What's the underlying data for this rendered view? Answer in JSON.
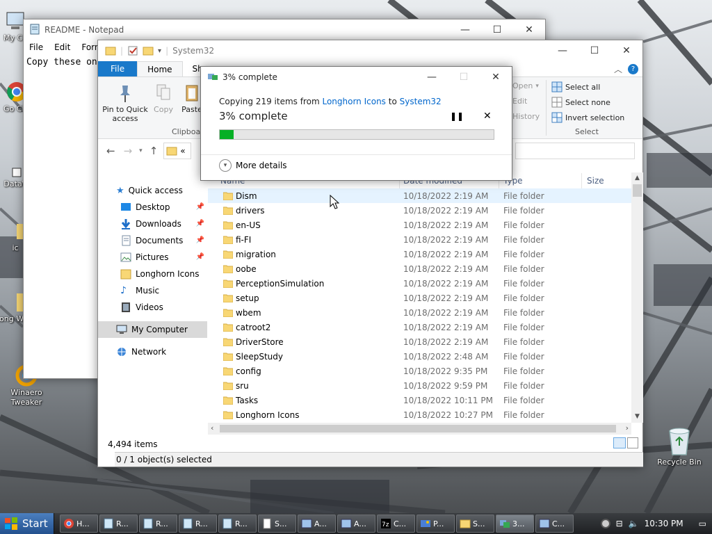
{
  "desktop": {
    "icons": [
      {
        "label": "My Co"
      },
      {
        "label": "Go Chr"
      },
      {
        "label": "DataW"
      },
      {
        "label": "ic"
      },
      {
        "label": "Long Wind"
      },
      {
        "label": "Winaero Tweaker"
      },
      {
        "label": "Recycle Bin"
      }
    ]
  },
  "notepad": {
    "title": "README - Notepad",
    "menu": [
      "File",
      "Edit",
      "Forma"
    ],
    "text": "Copy these on"
  },
  "explorer": {
    "title": "System32",
    "tabs": [
      "File",
      "Home",
      "Sha"
    ],
    "ribbon": {
      "pin_label": "Pin to Quick access",
      "copy_label": "Copy",
      "paste_label": "Paste",
      "clipboard_group": "Clipboar",
      "open_label": "Open",
      "edit_label": "Edit",
      "history_label": "History",
      "select_all": "Select all",
      "select_none": "Select none",
      "invert_selection": "Invert selection",
      "select_group": "Select"
    },
    "address_prefix": "«",
    "nav": {
      "quick_access": "Quick access",
      "items": [
        "Desktop",
        "Downloads",
        "Documents",
        "Pictures",
        "Longhorn Icons",
        "Music",
        "Videos"
      ],
      "my_computer": "My Computer",
      "network": "Network"
    },
    "columns": {
      "name": "Name",
      "date": "Date modified",
      "type": "Type",
      "size": "Size"
    },
    "files": [
      {
        "name": "Dism",
        "date": "10/18/2022 2:19 AM",
        "type": "File folder"
      },
      {
        "name": "drivers",
        "date": "10/18/2022 2:19 AM",
        "type": "File folder"
      },
      {
        "name": "en-US",
        "date": "10/18/2022 2:19 AM",
        "type": "File folder"
      },
      {
        "name": "fi-FI",
        "date": "10/18/2022 2:19 AM",
        "type": "File folder"
      },
      {
        "name": "migration",
        "date": "10/18/2022 2:19 AM",
        "type": "File folder"
      },
      {
        "name": "oobe",
        "date": "10/18/2022 2:19 AM",
        "type": "File folder"
      },
      {
        "name": "PerceptionSimulation",
        "date": "10/18/2022 2:19 AM",
        "type": "File folder"
      },
      {
        "name": "setup",
        "date": "10/18/2022 2:19 AM",
        "type": "File folder"
      },
      {
        "name": "wbem",
        "date": "10/18/2022 2:19 AM",
        "type": "File folder"
      },
      {
        "name": "catroot2",
        "date": "10/18/2022 2:19 AM",
        "type": "File folder"
      },
      {
        "name": "DriverStore",
        "date": "10/18/2022 2:19 AM",
        "type": "File folder"
      },
      {
        "name": "SleepStudy",
        "date": "10/18/2022 2:48 AM",
        "type": "File folder"
      },
      {
        "name": "config",
        "date": "10/18/2022 9:35 PM",
        "type": "File folder"
      },
      {
        "name": "sru",
        "date": "10/18/2022 9:59 PM",
        "type": "File folder"
      },
      {
        "name": "Tasks",
        "date": "10/18/2022 10:11 PM",
        "type": "File folder"
      },
      {
        "name": "Longhorn Icons",
        "date": "10/18/2022 10:27 PM",
        "type": "File folder"
      }
    ],
    "item_count": "4,494 items"
  },
  "copy_dialog": {
    "title": "3% complete",
    "line_prefix": "Copying 219 items from",
    "source": "Longhorn Icons",
    "to_word": "to",
    "dest": "System32",
    "heading": "3% complete",
    "progress": 0.05,
    "more_details": "More details"
  },
  "notepad_status": "0 / 1 object(s) selected",
  "taskbar": {
    "start": "Start",
    "buttons": [
      {
        "label": "H...",
        "icon": "chrome-icon"
      },
      {
        "label": "R...",
        "icon": "notepad-icon"
      },
      {
        "label": "R...",
        "icon": "notepad-icon"
      },
      {
        "label": "R...",
        "icon": "notepad-icon"
      },
      {
        "label": "R...",
        "icon": "notepad-icon"
      },
      {
        "label": "S...",
        "icon": "document-icon"
      },
      {
        "label": "A...",
        "icon": "app-icon"
      },
      {
        "label": "A...",
        "icon": "app-icon"
      },
      {
        "label": "C...",
        "icon": "7zip-icon"
      },
      {
        "label": "P...",
        "icon": "paint-icon"
      },
      {
        "label": "S...",
        "icon": "folder-icon"
      },
      {
        "label": "3...",
        "icon": "copy-progress-icon"
      },
      {
        "label": "C...",
        "icon": "app-icon"
      }
    ],
    "clock": "10:30 PM"
  }
}
